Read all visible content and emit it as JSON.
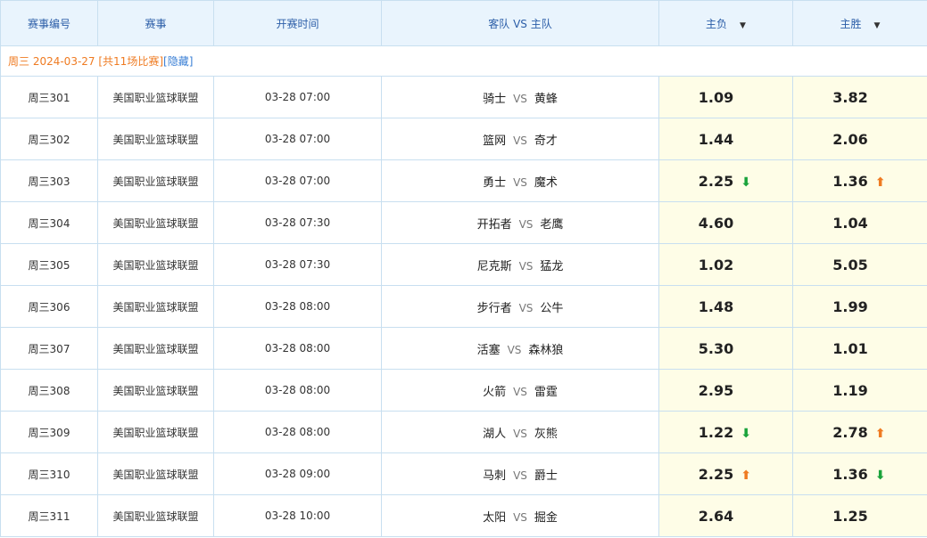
{
  "header": {
    "match_no": "赛事编号",
    "league": "赛事",
    "kickoff": "开赛时间",
    "teams": "客队 VS 主队",
    "away_win": "主负",
    "home_win": "主胜"
  },
  "date_row": {
    "label": "周三 2024-03-27 [共11场比赛]",
    "hide": "[隐藏]"
  },
  "vs_label": "VS",
  "colors": {
    "arrow_down": "#1aa33b",
    "arrow_up": "#ef7b22",
    "odds_bg": "#fefde7"
  },
  "matches": [
    {
      "no": "周三301",
      "league": "美国职业篮球联盟",
      "time": "03-28 07:00",
      "away": "骑士",
      "home": "黄蜂",
      "lose": "1.09",
      "lose_trend": "none",
      "win": "3.82",
      "win_trend": "none"
    },
    {
      "no": "周三302",
      "league": "美国职业篮球联盟",
      "time": "03-28 07:00",
      "away": "篮网",
      "home": "奇才",
      "lose": "1.44",
      "lose_trend": "none",
      "win": "2.06",
      "win_trend": "none"
    },
    {
      "no": "周三303",
      "league": "美国职业篮球联盟",
      "time": "03-28 07:00",
      "away": "勇士",
      "home": "魔术",
      "lose": "2.25",
      "lose_trend": "down",
      "win": "1.36",
      "win_trend": "up"
    },
    {
      "no": "周三304",
      "league": "美国职业篮球联盟",
      "time": "03-28 07:30",
      "away": "开拓者",
      "home": "老鹰",
      "lose": "4.60",
      "lose_trend": "none",
      "win": "1.04",
      "win_trend": "none"
    },
    {
      "no": "周三305",
      "league": "美国职业篮球联盟",
      "time": "03-28 07:30",
      "away": "尼克斯",
      "home": "猛龙",
      "lose": "1.02",
      "lose_trend": "none",
      "win": "5.05",
      "win_trend": "none"
    },
    {
      "no": "周三306",
      "league": "美国职业篮球联盟",
      "time": "03-28 08:00",
      "away": "步行者",
      "home": "公牛",
      "lose": "1.48",
      "lose_trend": "none",
      "win": "1.99",
      "win_trend": "none"
    },
    {
      "no": "周三307",
      "league": "美国职业篮球联盟",
      "time": "03-28 08:00",
      "away": "活塞",
      "home": "森林狼",
      "lose": "5.30",
      "lose_trend": "none",
      "win": "1.01",
      "win_trend": "none"
    },
    {
      "no": "周三308",
      "league": "美国职业篮球联盟",
      "time": "03-28 08:00",
      "away": "火箭",
      "home": "雷霆",
      "lose": "2.95",
      "lose_trend": "none",
      "win": "1.19",
      "win_trend": "none"
    },
    {
      "no": "周三309",
      "league": "美国职业篮球联盟",
      "time": "03-28 08:00",
      "away": "湖人",
      "home": "灰熊",
      "lose": "1.22",
      "lose_trend": "down",
      "win": "2.78",
      "win_trend": "up"
    },
    {
      "no": "周三310",
      "league": "美国职业篮球联盟",
      "time": "03-28 09:00",
      "away": "马刺",
      "home": "爵士",
      "lose": "2.25",
      "lose_trend": "up",
      "win": "1.36",
      "win_trend": "down"
    },
    {
      "no": "周三311",
      "league": "美国职业篮球联盟",
      "time": "03-28 10:00",
      "away": "太阳",
      "home": "掘金",
      "lose": "2.64",
      "lose_trend": "none",
      "win": "1.25",
      "win_trend": "none"
    }
  ]
}
